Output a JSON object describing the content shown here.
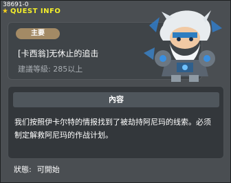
{
  "quest": {
    "id": "38691-0",
    "title_bar": "QUEST INFO",
    "badge": "主要",
    "name": "[卡西翁]无休止的追击",
    "level_requirement": "建議等級: 285以上"
  },
  "description": {
    "header": "內容",
    "text": "我们按照伊卡尔特的情报找到了被劫持阿尼玛的线索。必须制定解救阿尼玛的作战计划。"
  },
  "status": {
    "label": "狀態:",
    "value": "可開始"
  },
  "icons": {
    "title_icon": "star-icon",
    "portrait": "npc-portrait-icon"
  },
  "colors": {
    "title_yellow": "#f4ef2a",
    "badge_tan": "#a38a65",
    "panel_dark": "#3f4448"
  }
}
